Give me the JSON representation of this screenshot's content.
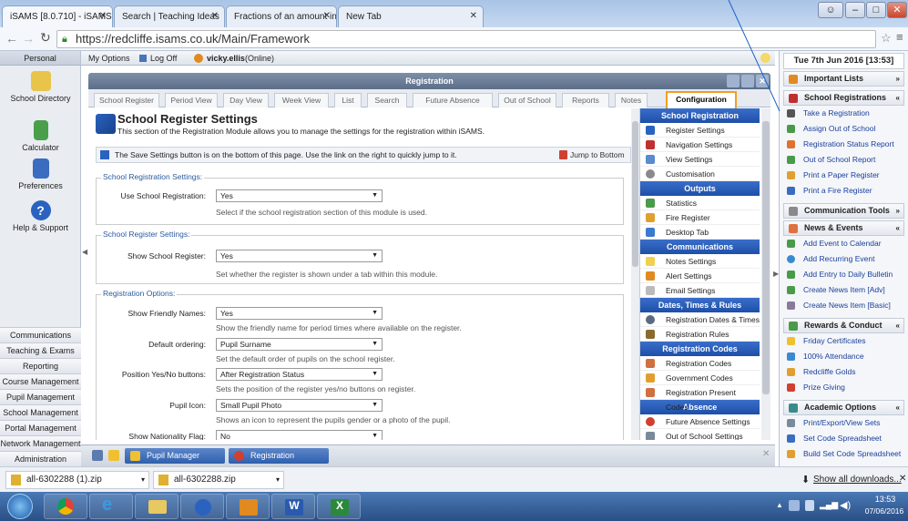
{
  "browser": {
    "tabs": [
      {
        "label": "iSAMS [8.0.710] - iSAMS D"
      },
      {
        "label": "Search | Teaching Ideas"
      },
      {
        "label": "Fractions of an amount in"
      },
      {
        "label": "New Tab"
      }
    ],
    "url": "https://redcliffe.isams.co.uk/Main/Framework"
  },
  "left_nav": {
    "header": "Personal",
    "apps": [
      {
        "label": "School Directory",
        "icon": "school-directory-icon",
        "color": "#e8c44a"
      },
      {
        "label": "Calculator",
        "icon": "calculator-icon",
        "color": "#4aa04a"
      },
      {
        "label": "Preferences",
        "icon": "preferences-icon",
        "color": "#3a6cc0"
      },
      {
        "label": "Help & Support",
        "icon": "help-icon",
        "color": "#2a62c0"
      }
    ],
    "modules": [
      "Communications",
      "Teaching & Exams",
      "Reporting",
      "Course Management",
      "Pupil Management",
      "School Management",
      "Portal Management",
      "Network Management",
      "Administration"
    ]
  },
  "top_menu": {
    "my_options": "My Options",
    "log_off": "Log Off",
    "user": "vicky.ellis",
    "status": "(Online)"
  },
  "module_window": {
    "title": "Registration",
    "tabs": [
      "School Register",
      "Period View",
      "Day View",
      "Week View",
      "List",
      "Search",
      "Future Absence",
      "Out of School",
      "Reports",
      "Notes",
      "Configuration"
    ],
    "active_tab": "Configuration"
  },
  "settings": {
    "title": "School Register Settings",
    "subtitle": "This section of the Registration Module allows you to manage the settings for the registration within iSAMS.",
    "notice": "The Save Settings button is on the bottom of this page. Use the link on the right to quickly jump to it.",
    "jump_link": "Jump to Bottom",
    "sections": [
      {
        "legend": "School Registration Settings:",
        "fields": [
          {
            "label": "Use School Registration:",
            "value": "Yes",
            "help": "Select if the school registration section of this module is used."
          }
        ]
      },
      {
        "legend": "School Register Settings:",
        "fields": [
          {
            "label": "Show School Register:",
            "value": "Yes",
            "help": "Set whether the register is shown under a tab within this module."
          }
        ]
      },
      {
        "legend": "Registration Options:",
        "fields": [
          {
            "label": "Show Friendly Names:",
            "value": "Yes",
            "help": "Show the friendly name for period times where available on the register."
          },
          {
            "label": "Default ordering:",
            "value": "Pupil Surname",
            "help": "Set the default order of pupils on the school register."
          },
          {
            "label": "Position Yes/No buttons:",
            "value": "After Registration Status",
            "help": "Sets the position of the register yes/no buttons on register."
          },
          {
            "label": "Pupil Icon:",
            "value": "Small Pupil Photo",
            "help": "Shows an icon to represent the pupils gender or a photo of the pupil."
          },
          {
            "label": "Show Nationality Flag:",
            "value": "No",
            "help": ""
          }
        ]
      }
    ]
  },
  "config_menu": [
    {
      "header": "School Registration",
      "items": [
        "Register Settings",
        "Navigation Settings",
        "View Settings",
        "Customisation"
      ]
    },
    {
      "header": "Outputs",
      "items": [
        "Statistics",
        "Fire Register",
        "Desktop Tab"
      ]
    },
    {
      "header": "Communications",
      "items": [
        "Notes Settings",
        "Alert Settings",
        "Email Settings"
      ]
    },
    {
      "header": "Dates, Times & Rules",
      "items": [
        "Registration Dates & Times",
        "Registration Rules"
      ]
    },
    {
      "header": "Registration Codes",
      "items": [
        "Registration Codes",
        "Government Codes",
        "Registration Present Codes"
      ]
    },
    {
      "header": "Absence",
      "items": [
        "Future Absence Settings",
        "Out of School Settings"
      ]
    }
  ],
  "right_panel": {
    "date": "Tue 7th Jun 2016 [13:53]",
    "sections": [
      {
        "title": "Important Lists",
        "expanded": false,
        "items": []
      },
      {
        "title": "School Registrations",
        "expanded": true,
        "items": [
          "Take a Registration",
          "Assign Out of School",
          "Registration Status Report",
          "Out of School Report",
          "Print a Paper Register",
          "Print a Fire Register"
        ]
      },
      {
        "title": "Communication Tools",
        "expanded": false,
        "items": []
      },
      {
        "title": "News & Events",
        "expanded": true,
        "items": [
          "Add Event to Calendar",
          "Add Recurring Event",
          "Add Entry to Daily Bulletin",
          "Create News Item [Adv]",
          "Create News Item [Basic]"
        ]
      },
      {
        "title": "Rewards & Conduct",
        "expanded": true,
        "items": [
          "Friday Certificates",
          "100% Attendance",
          "Redcliffe Golds",
          "Prize Giving"
        ]
      },
      {
        "title": "Academic Options",
        "expanded": true,
        "items": [
          "Print/Export/View Sets",
          "Set Code Spreadsheet",
          "Build Set Code Spreadsheet"
        ]
      }
    ]
  },
  "app_taskbar": {
    "tasks": [
      "Pupil Manager",
      "Registration"
    ]
  },
  "downloads": {
    "items": [
      "all-6302288 (1).zip",
      "all-6302288.zip"
    ],
    "show_all": "Show all downloads..."
  },
  "system_tray": {
    "time": "13:53",
    "date": "07/06/2016"
  }
}
